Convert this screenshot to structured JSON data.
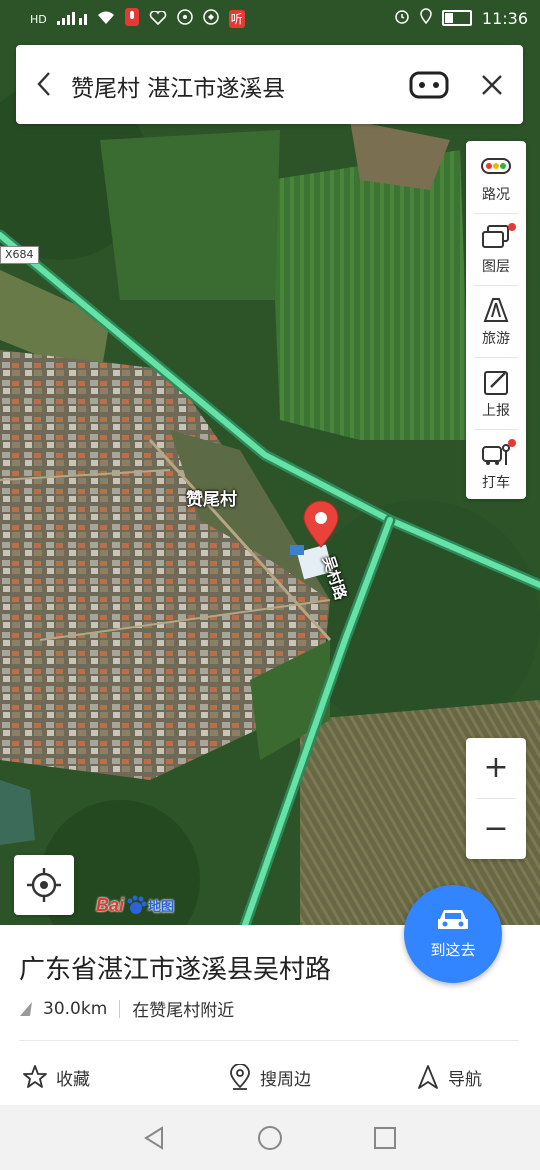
{
  "status_bar": {
    "left_label": "HD",
    "badge": "听",
    "time": "11:36"
  },
  "search": {
    "query": "赞尾村 湛江市遂溪县"
  },
  "toolbar": [
    {
      "label": "路况",
      "icon": "traffic-light-icon",
      "dot": false
    },
    {
      "label": "图层",
      "icon": "layers-icon",
      "dot": true
    },
    {
      "label": "旅游",
      "icon": "travel-icon",
      "dot": false
    },
    {
      "label": "上报",
      "icon": "report-icon",
      "dot": false
    },
    {
      "label": "打车",
      "icon": "taxi-icon",
      "dot": true
    }
  ],
  "zoom": {
    "in": "+",
    "out": "−"
  },
  "map": {
    "village_label": "赞尾村",
    "road_label": "吴村路",
    "road_shield": "X684"
  },
  "logo": {
    "text": "Bai",
    "suffix": "地图"
  },
  "go_button": {
    "label": "到这去"
  },
  "place": {
    "address": "广东省湛江市遂溪县吴村路",
    "distance": "30.0km",
    "nearby": "在赞尾村附近"
  },
  "actions": {
    "favorite": "收藏",
    "nearby_search": "搜周边",
    "navigate": "导航"
  },
  "colors": {
    "accent": "#3385ff",
    "pin": "#e8423b",
    "road": "#66e2a6"
  }
}
